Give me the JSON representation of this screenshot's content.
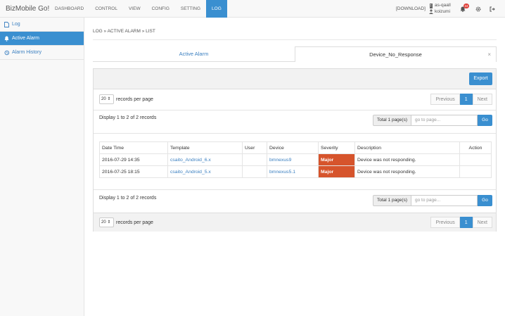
{
  "app": {
    "brand": "BizMobile Go!"
  },
  "nav": [
    "DASHBOARD",
    "CONTROL",
    "VIEW",
    "CONFIG",
    "SETTING",
    "LOG"
  ],
  "header": {
    "download": "[DOWNLOAD]",
    "org": "as-qaall",
    "user": "koizumi",
    "badge": "24"
  },
  "sidebar": {
    "items": [
      {
        "label": "Log"
      },
      {
        "label": "Active Alarm"
      },
      {
        "label": "Alarm History"
      }
    ]
  },
  "breadcrumb": "LOG » ACTIVE ALARM » LIST",
  "tabs": {
    "active_alarm": "Active Alarm",
    "device": "Device_No_Response",
    "close": "×"
  },
  "toolbar": {
    "export": "Export"
  },
  "pagination": {
    "per_page_value": "20",
    "per_page_label": "records per page",
    "prev": "Previous",
    "page": "1",
    "next": "Next",
    "display": "Display 1 to 2 of 2 records",
    "total": "Total 1 page(s)",
    "placeholder": "go to page...",
    "go": "Go"
  },
  "table": {
    "headers": [
      "Date Time",
      "Template",
      "User",
      "Device",
      "Severity",
      "Description",
      "Action"
    ],
    "rows": [
      {
        "datetime": "2016-07-29 14:35",
        "template": "csaito_Android_6.x",
        "user": "",
        "device": "bmnexus9",
        "severity": "Major",
        "description": "Device was not responding.",
        "action": ""
      },
      {
        "datetime": "2016-07-25 18:15",
        "template": "csaito_Android_5.x",
        "user": "",
        "device": "bmnexus5.1",
        "severity": "Major",
        "description": "Device was not responding.",
        "action": ""
      }
    ]
  },
  "colors": {
    "accent": "#3a8fd0",
    "severity_major": "#d6542c",
    "badge": "#e0413a"
  }
}
